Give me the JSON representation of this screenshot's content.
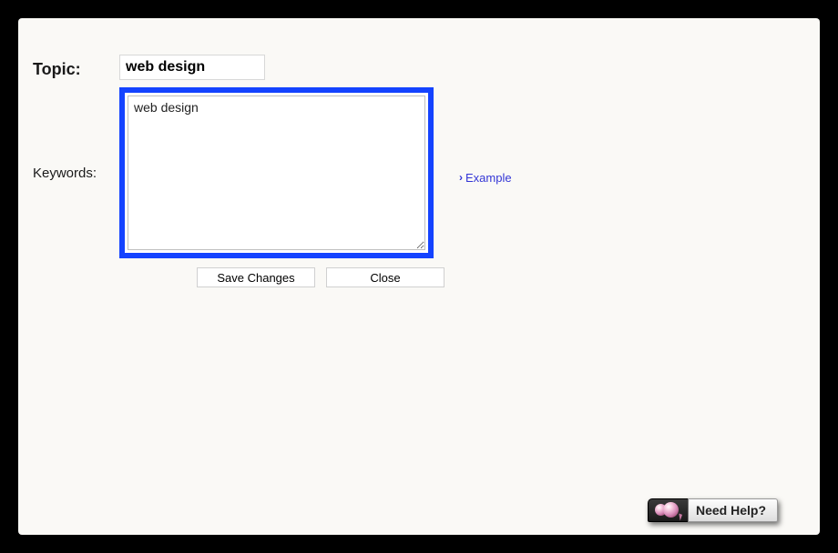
{
  "form": {
    "topic_label": "Topic:",
    "topic_value": "web design",
    "keywords_label": "Keywords:",
    "keywords_value": "web design",
    "example_link": "Example",
    "save_label": "Save Changes",
    "close_label": "Close"
  },
  "help_widget": {
    "label": "Need Help?"
  }
}
